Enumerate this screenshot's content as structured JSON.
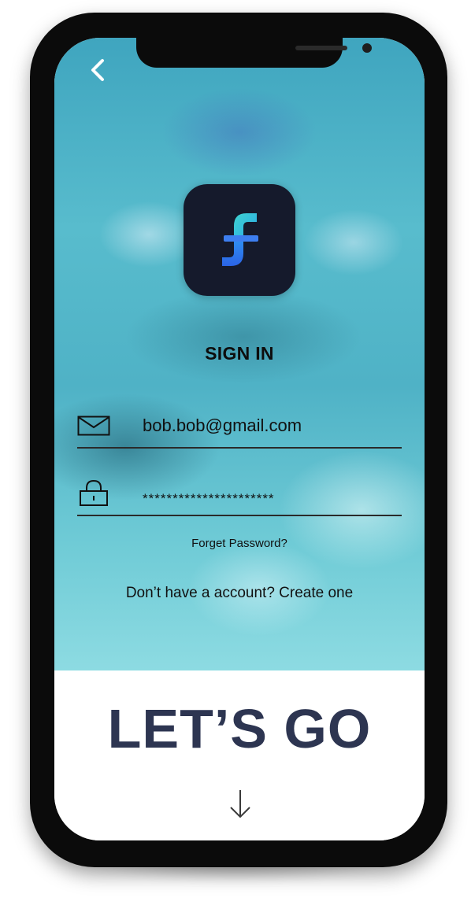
{
  "header": {
    "back_icon": "chevron-left-icon"
  },
  "logo": {
    "icon": "f-letter-logo-icon",
    "background_color": "#151a2c",
    "accent_colors": [
      "#39c9d6",
      "#2f6df0"
    ]
  },
  "form": {
    "title": "SIGN IN",
    "email": {
      "icon": "envelope-icon",
      "value": "bob.bob@gmail.com"
    },
    "password": {
      "icon": "lock-icon",
      "value": "**********************"
    },
    "forgot_password_label": "Forget Password?",
    "create_account_label": "Don’t have a account? Create one"
  },
  "cta": {
    "label": "LET’S GO",
    "color": "#2d3551",
    "arrow_icon": "arrow-down-icon"
  }
}
